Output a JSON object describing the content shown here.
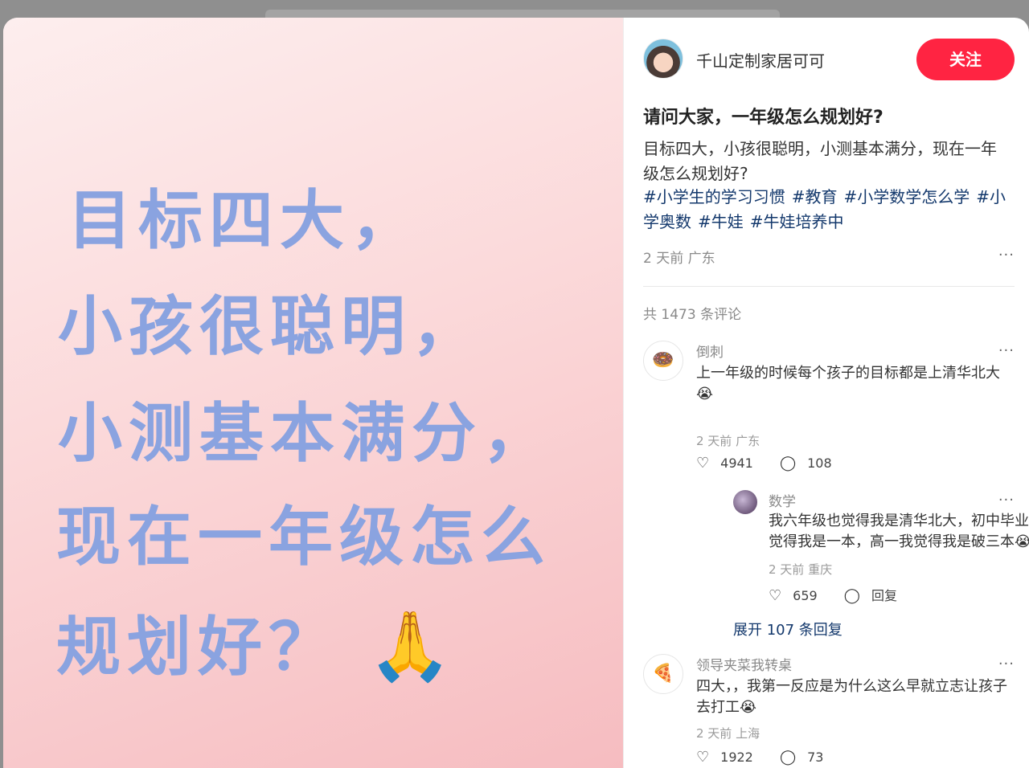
{
  "poster": {
    "lines": [
      "目标四大，",
      "小孩很聪明，",
      "小测基本满分，",
      "现在一年级怎么",
      "规划好？"
    ],
    "emoji": "🙏"
  },
  "author": {
    "name": "千山定制家居可可",
    "follow_label": "关注"
  },
  "post": {
    "title": "请问大家，一年级怎么规划好?",
    "body": "目标四大，小孩很聪明，小测基本满分，现在一年级怎么规划好?",
    "tags": [
      "#小学生的学习习惯",
      "#教育",
      "#小学数学怎么学",
      "#小学奥数",
      "#牛娃",
      "#牛娃培养中"
    ],
    "meta": "2 天前 广东",
    "more": "···"
  },
  "comments_header": "共 1473 条评论",
  "comments": [
    {
      "name": "倒刺",
      "avatar": "🍩",
      "text": "上一年级的时候每个孩子的目标都是上清华北大😭",
      "meta": "2 天前 广东",
      "likes": "4941",
      "replies": "108",
      "reply": {
        "name": "数学",
        "text": "我六年级也觉得我是清华北大，初中毕业我觉得我是一本，高一我觉得我是破三本😭",
        "meta": "2 天前 重庆",
        "likes": "659",
        "reply_label": "回复"
      },
      "expand_label": "展开 107 条回复"
    },
    {
      "name": "领导夹菜我转桌",
      "avatar": "🍕",
      "text": "四大，，我第一反应是为什么这么早就立志让孩子去打工😭",
      "meta": "2 天前 上海",
      "likes": "1922",
      "replies": "73"
    }
  ],
  "icons": {
    "like": "heart-outline-icon",
    "comment": "speech-bubble-icon",
    "more": "ellipsis-icon"
  },
  "colors": {
    "accent": "#ff2442",
    "tag": "#13386c",
    "poster_text": "#8aa3e0"
  }
}
